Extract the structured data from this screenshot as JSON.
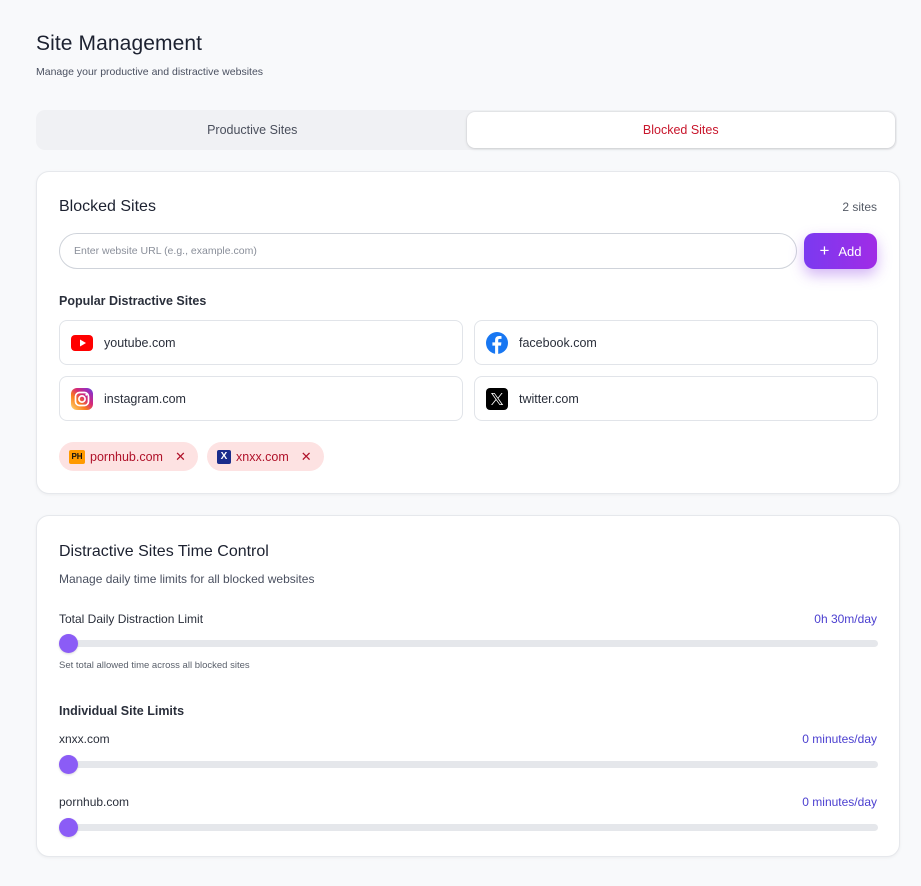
{
  "header": {
    "title": "Site Management",
    "subtitle": "Manage your productive and distractive websites"
  },
  "tabs": [
    {
      "label": "Productive Sites",
      "active": false
    },
    {
      "label": "Blocked Sites",
      "active": true
    }
  ],
  "blocked": {
    "title": "Blocked Sites",
    "count": "2 sites",
    "input_placeholder": "Enter website URL (e.g., example.com)",
    "input_value": "",
    "add_label": "Add",
    "popular_title": "Popular Distractive Sites",
    "popular": [
      {
        "label": "youtube.com",
        "icon": "youtube-icon"
      },
      {
        "label": "facebook.com",
        "icon": "facebook-icon"
      },
      {
        "label": "instagram.com",
        "icon": "instagram-icon"
      },
      {
        "label": "twitter.com",
        "icon": "x-twitter-icon"
      }
    ],
    "chips": [
      {
        "label": "pornhub.com",
        "icon": "pornhub-logo-icon",
        "logo_text": "PH",
        "remove": "✕"
      },
      {
        "label": "xnxx.com",
        "icon": "xnxx-logo-icon",
        "logo_text": "X",
        "remove": "✕"
      }
    ]
  },
  "time_control": {
    "title": "Distractive Sites Time Control",
    "description": "Manage daily time limits for all blocked websites",
    "total": {
      "label": "Total Daily Distraction Limit",
      "value": "0h 30m/day",
      "fraction": 0.0,
      "hint": "Set total allowed time across all blocked sites"
    },
    "individual_title": "Individual Site Limits",
    "sites": [
      {
        "label": "xnxx.com",
        "value": "0 minutes/day",
        "fraction": 0.0
      },
      {
        "label": "pornhub.com",
        "value": "0 minutes/day",
        "fraction": 0.0
      }
    ]
  },
  "colors": {
    "accent": "#8b5cf6",
    "active_tab_text": "#c8162c",
    "chip_bg": "#fde2e2",
    "value_text": "#4b3fd0"
  }
}
